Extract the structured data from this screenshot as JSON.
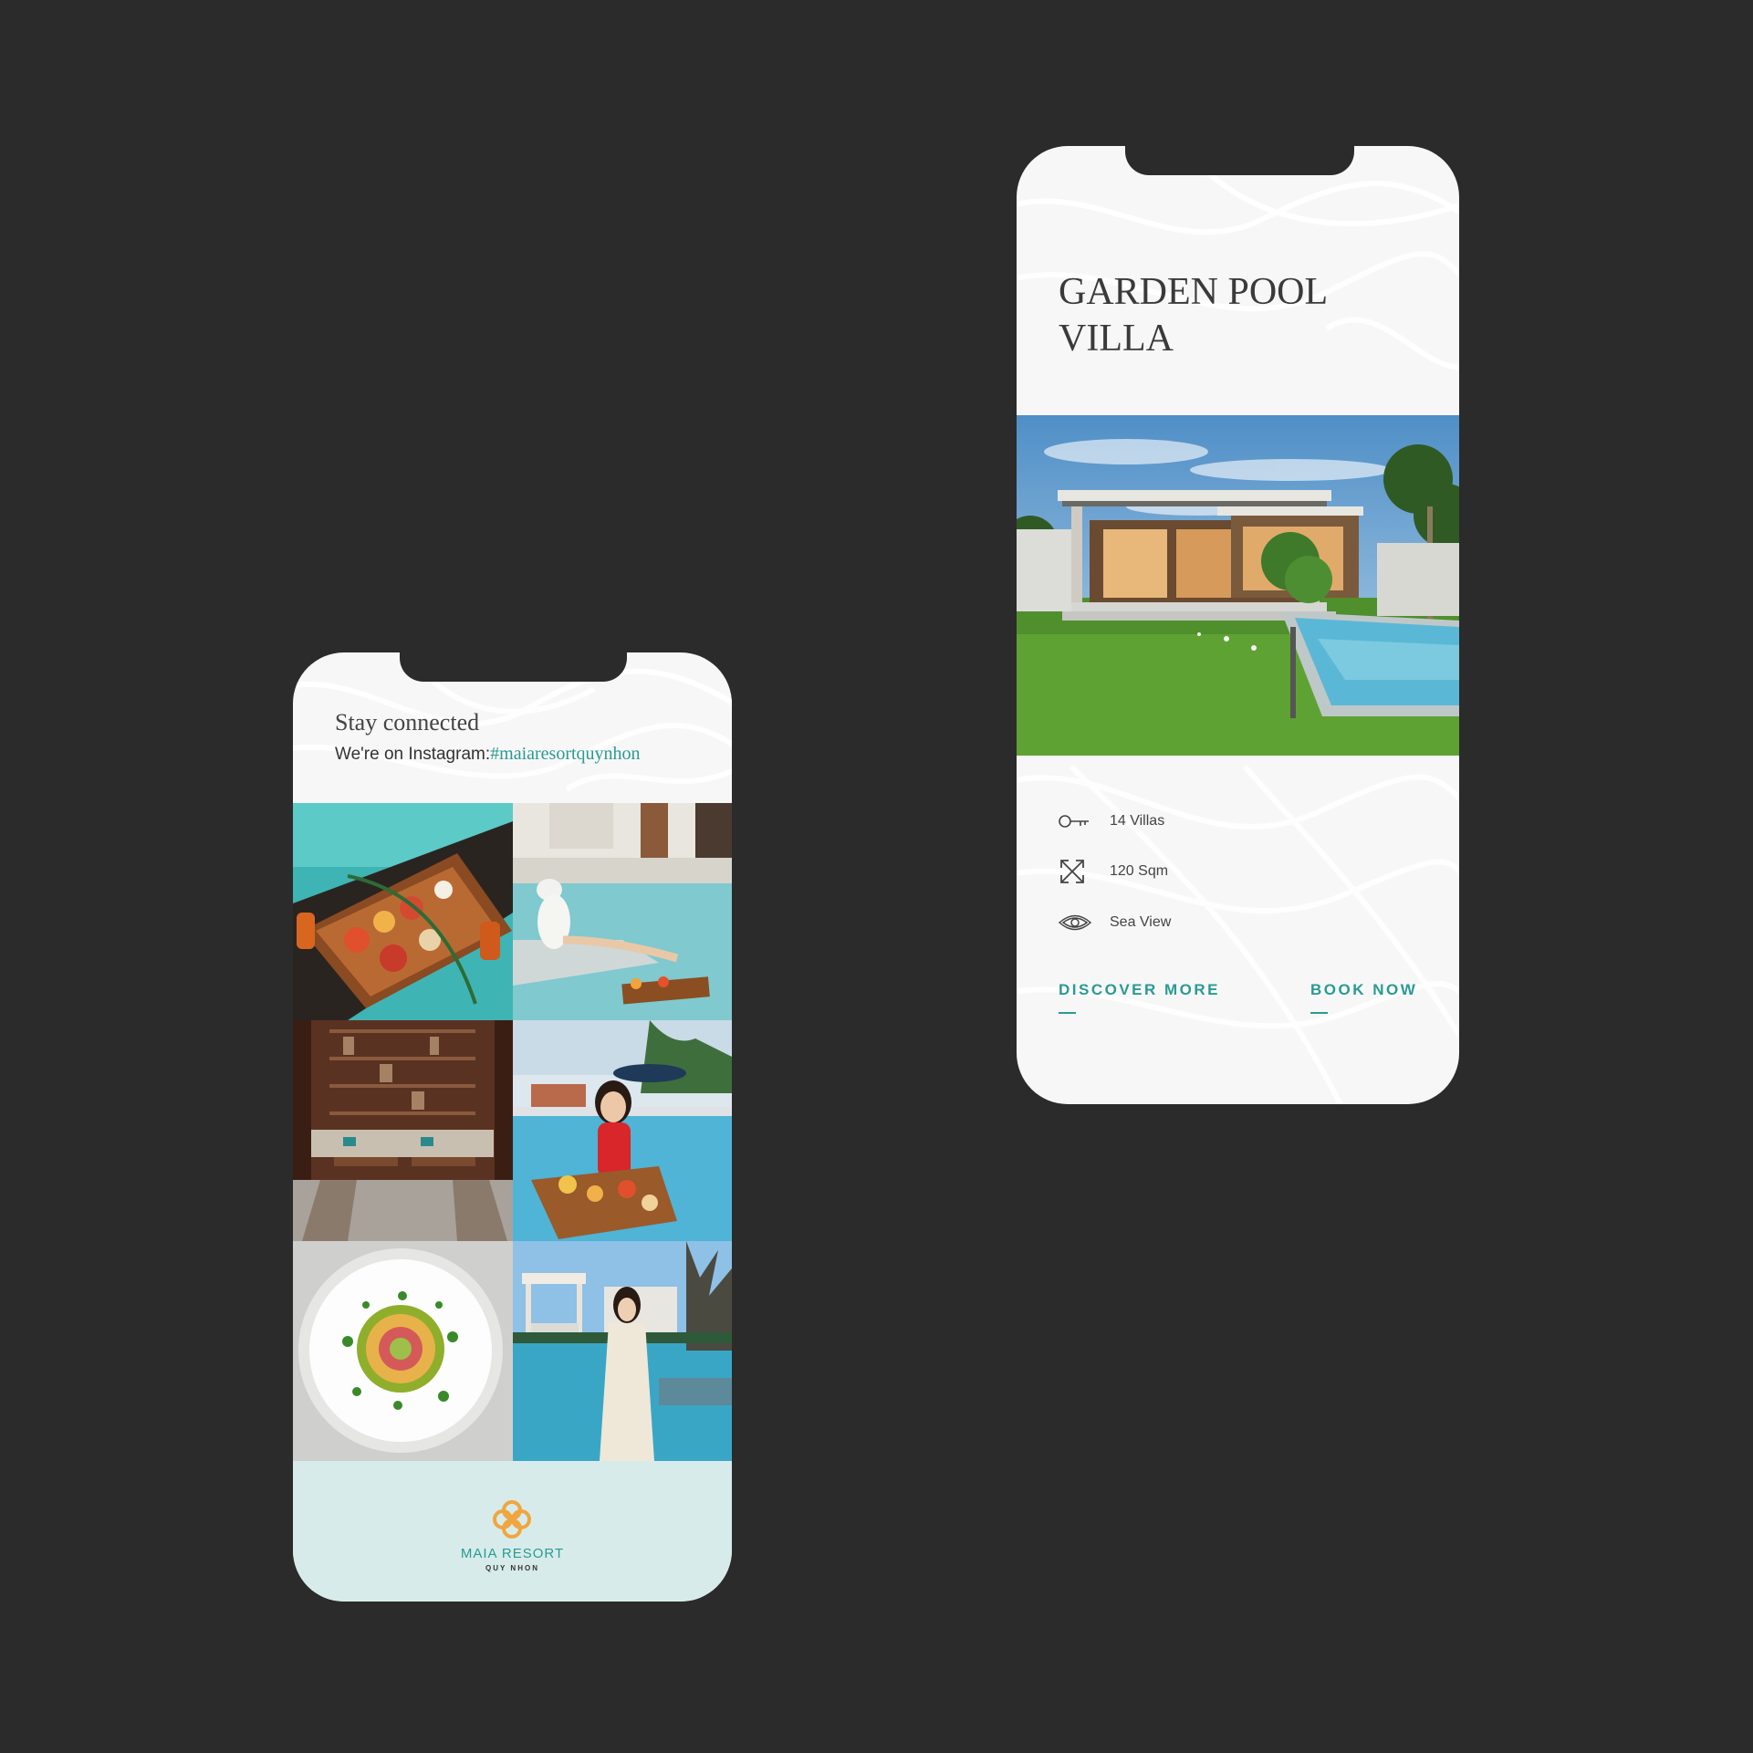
{
  "background_color": "#2b2b2b",
  "accent_color": "#2a9a93",
  "left_screen": {
    "heading": "Stay connected",
    "instagram_prefix": "We're on Instagram:",
    "instagram_hashtag": "#maiaresortquynhon",
    "photo_grid": [
      {
        "name": "breakfast-tray-photo"
      },
      {
        "name": "woman-pool-lounging-photo"
      },
      {
        "name": "restaurant-interior-photo"
      },
      {
        "name": "woman-floating-breakfast-photo"
      },
      {
        "name": "plated-dish-photo"
      },
      {
        "name": "woman-cabana-photo"
      }
    ],
    "footer": {
      "brand_name": "MAIA RESORT",
      "brand_location": "QUY NHON",
      "footer_color": "#d7ecea",
      "logo_color": "#f0a640"
    }
  },
  "right_screen": {
    "title_line1": "GARDEN POOL",
    "title_line2": "VILLA",
    "features": [
      {
        "icon": "key-icon",
        "label": "14 Villas"
      },
      {
        "icon": "expand-arrows-icon",
        "label": "120 Sqm"
      },
      {
        "icon": "eye-icon",
        "label": "Sea View"
      }
    ],
    "discover_label": "DISCOVER MORE",
    "book_label": "BOOK NOW"
  }
}
